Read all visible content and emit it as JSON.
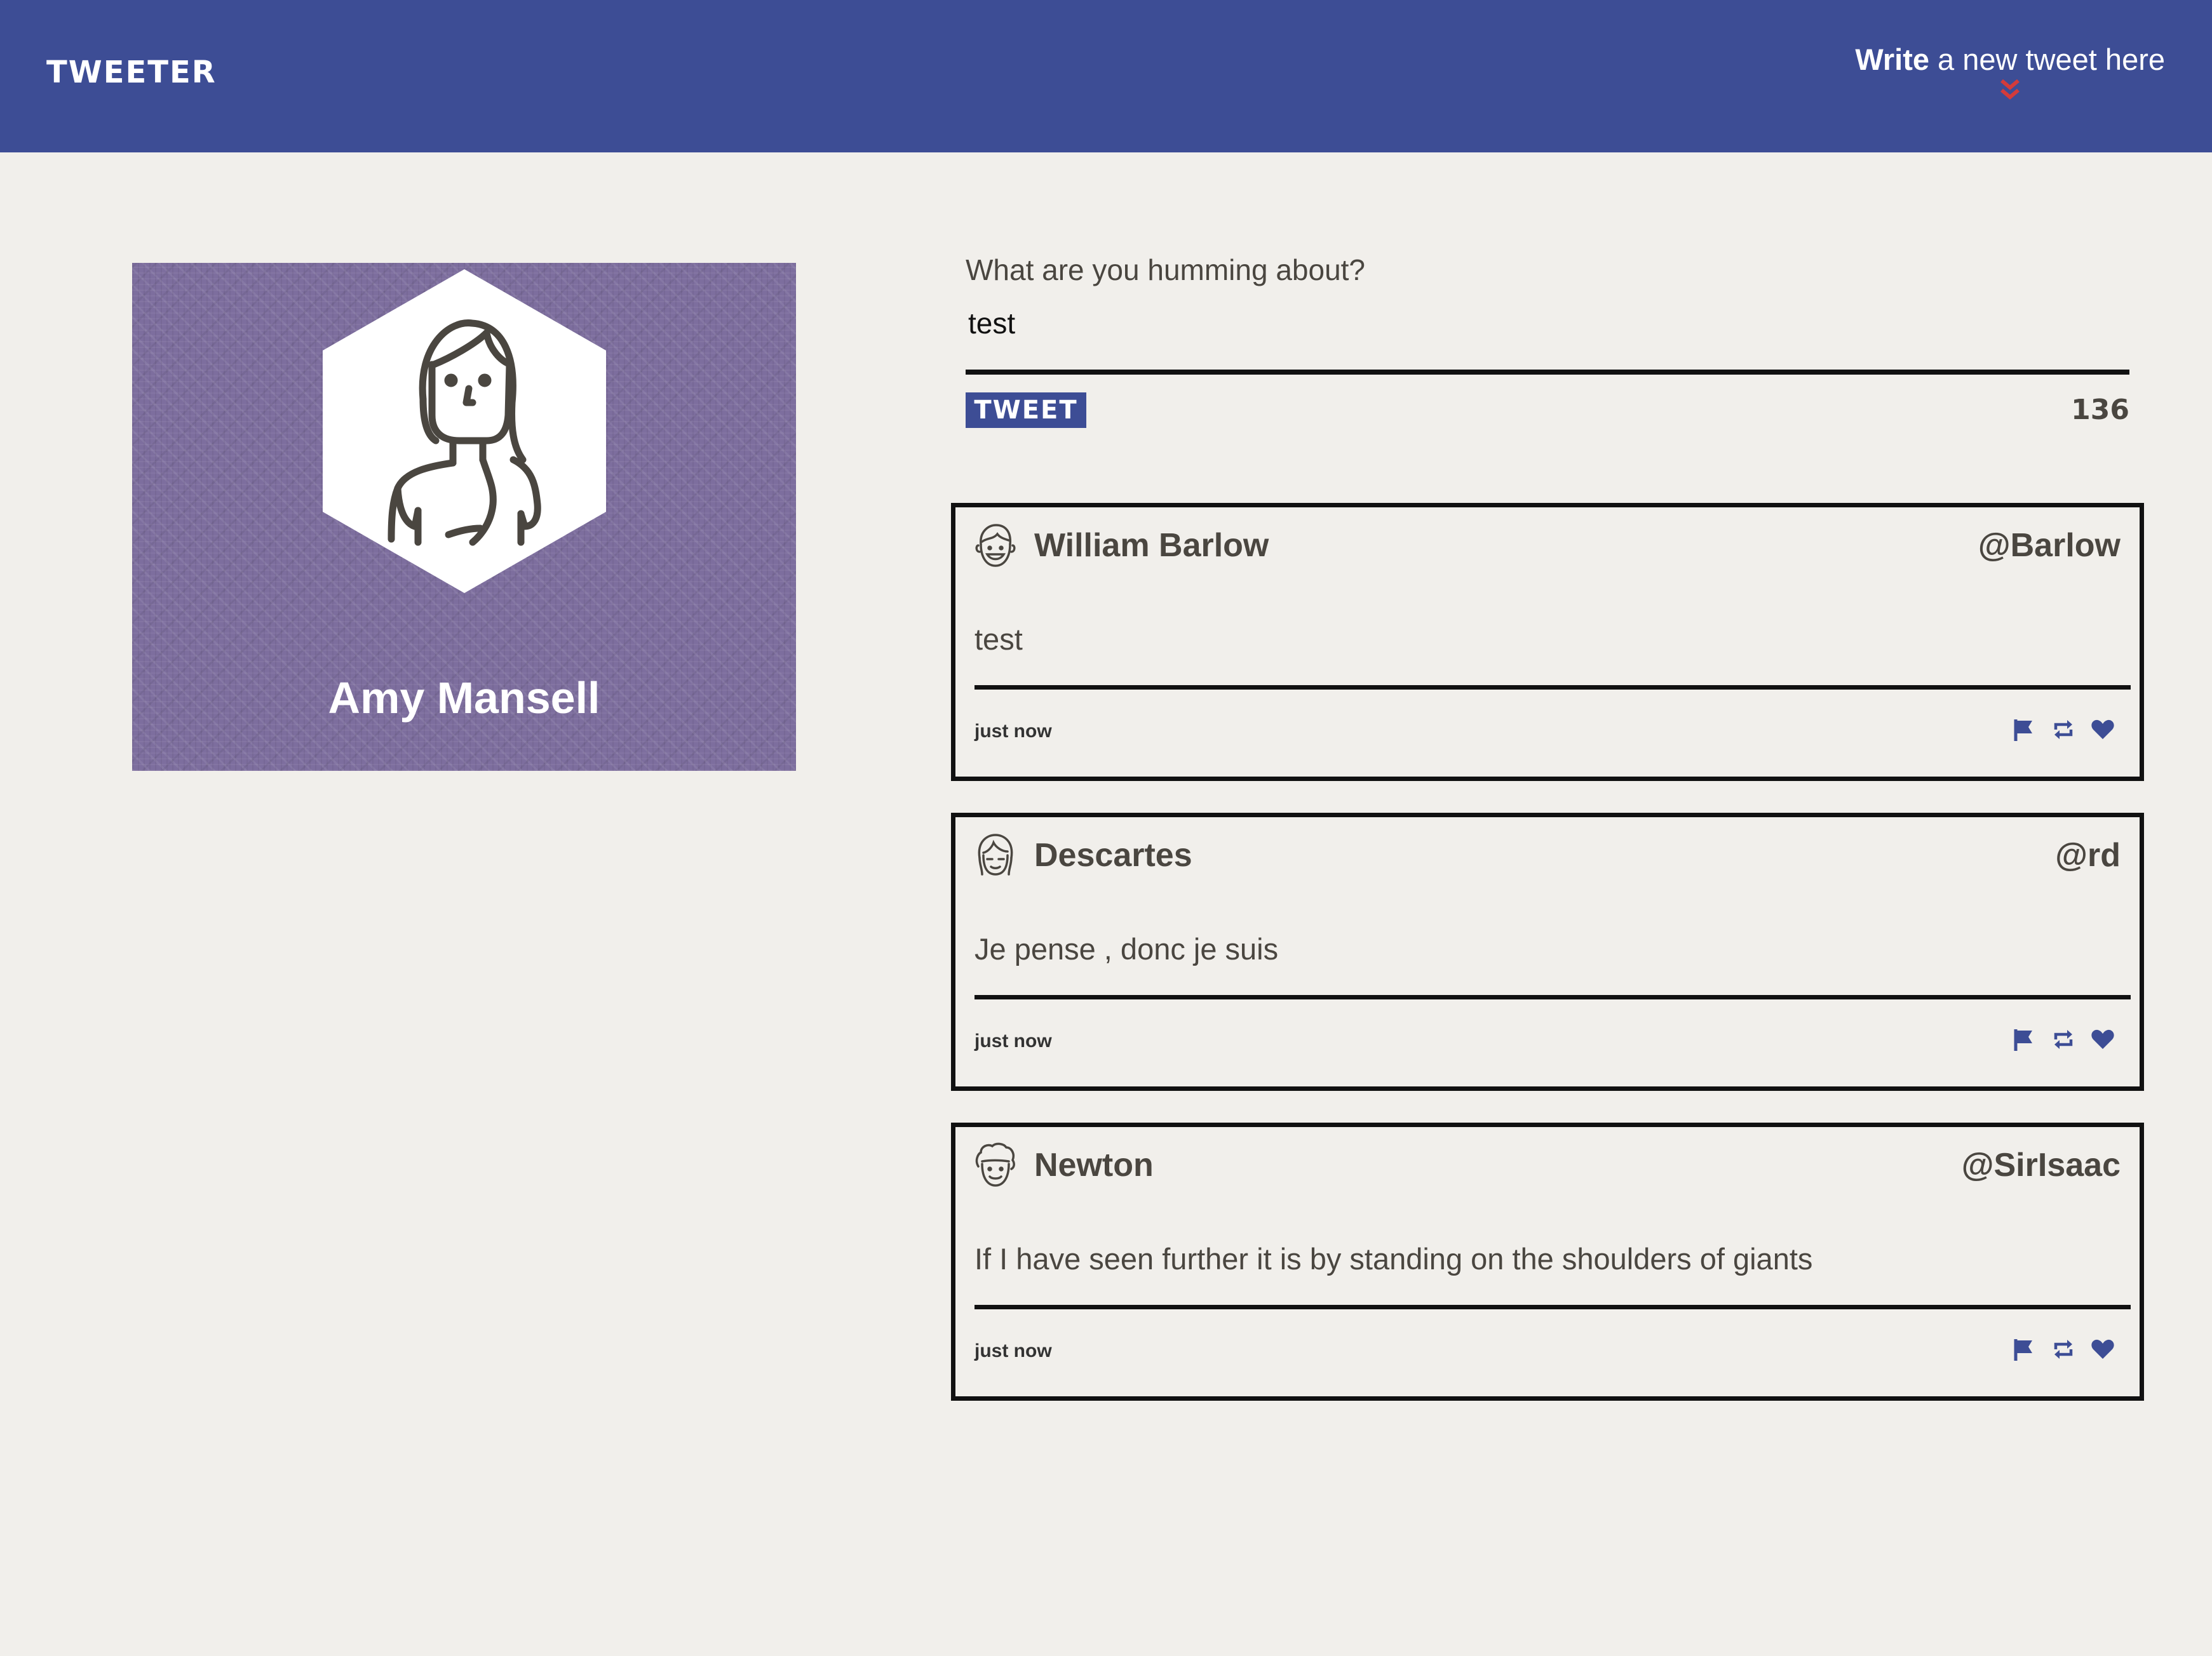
{
  "nav": {
    "logo": "TWEETER",
    "compose_bold": "Write",
    "compose_rest": " a new tweet here",
    "chevron_icon": "double-chevron-down-icon",
    "accent": "#3d4d95",
    "chevron_color": "#d33b3b"
  },
  "profile": {
    "name": "Amy Mansell",
    "avatar_icon": "user-avatar-icon"
  },
  "compose": {
    "label": "What are you humming about?",
    "value": "test",
    "button": "TWEET",
    "counter": "136"
  },
  "tweets": [
    {
      "name": "William Barlow",
      "handle": "@Barlow",
      "text": "test",
      "time": "just now"
    },
    {
      "name": "Descartes",
      "handle": "@rd",
      "text": "Je pense , donc je suis",
      "time": "just now"
    },
    {
      "name": "Newton",
      "handle": "@SirIsaac",
      "text": "If I have seen further it is by standing on the shoulders of giants",
      "time": "just now"
    }
  ]
}
